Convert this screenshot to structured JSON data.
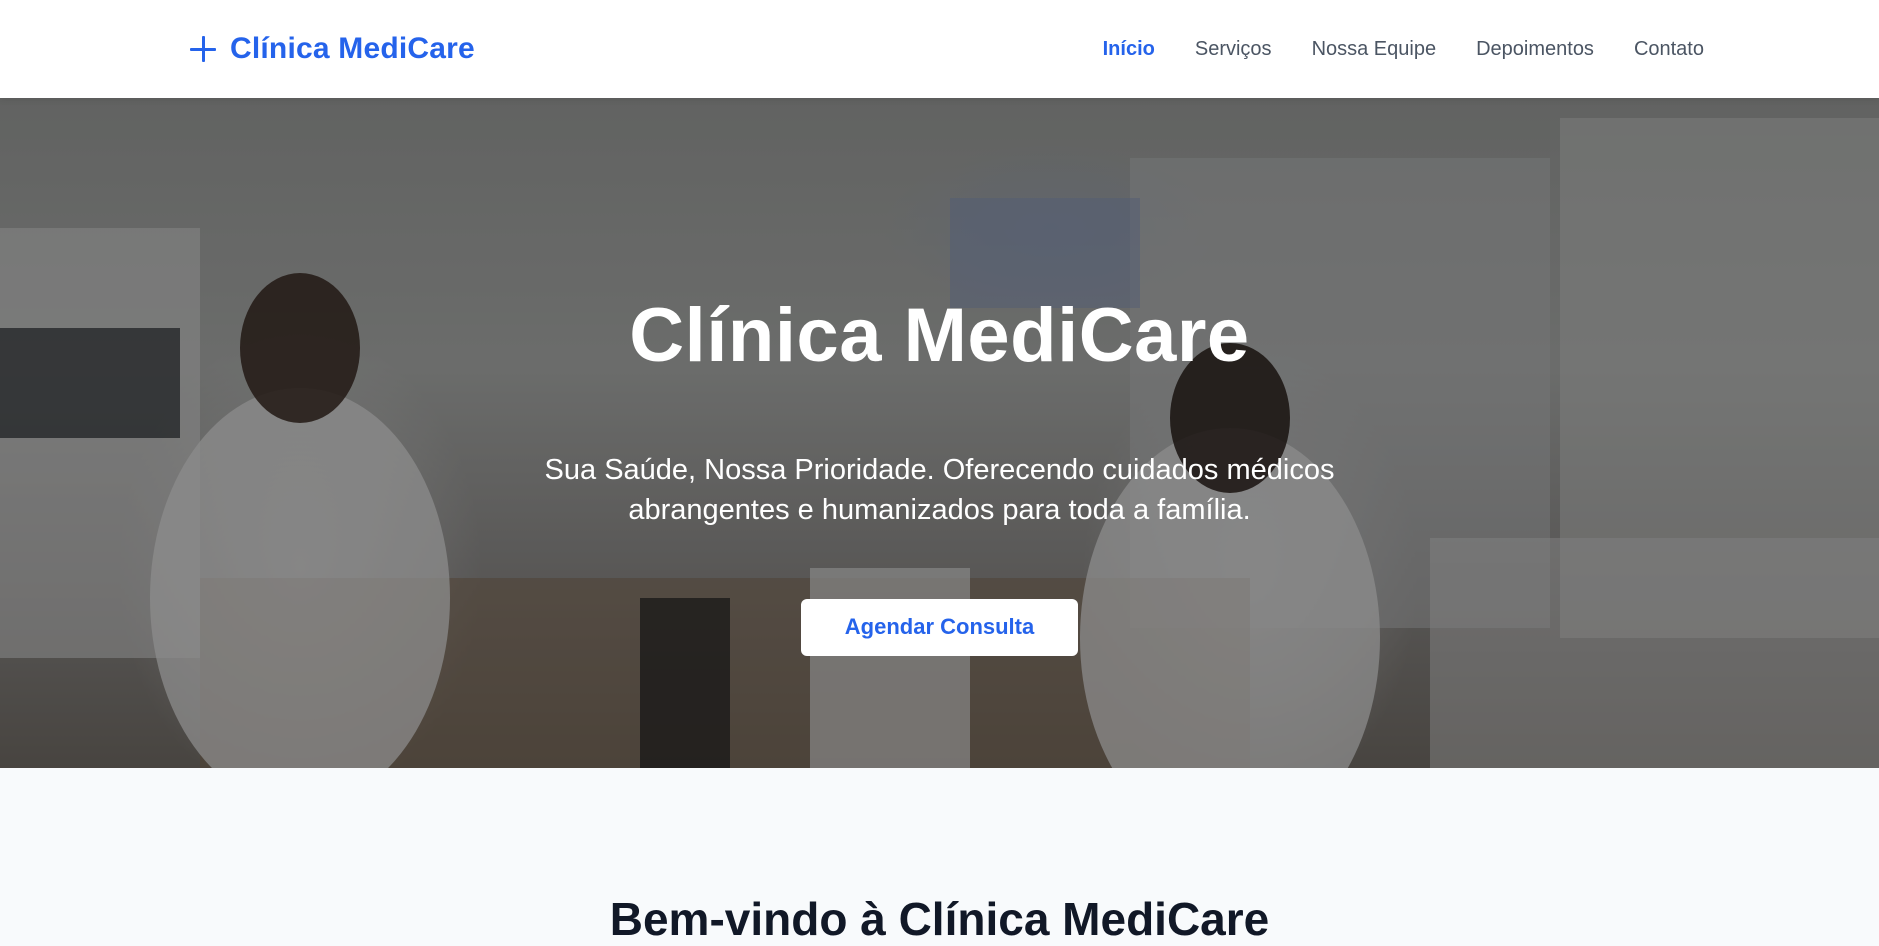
{
  "header": {
    "brand_icon": "plus-icon",
    "brand_name": "Clínica MediCare",
    "nav": [
      {
        "label": "Início",
        "active": true
      },
      {
        "label": "Serviços",
        "active": false
      },
      {
        "label": "Nossa Equipe",
        "active": false
      },
      {
        "label": "Depoimentos",
        "active": false
      },
      {
        "label": "Contato",
        "active": false
      }
    ]
  },
  "hero": {
    "title": "Clínica MediCare",
    "subtitle": "Sua Saúde, Nossa Prioridade. Oferecendo cuidados médicos abrangentes e humanizados para toda a família.",
    "cta_label": "Agendar Consulta"
  },
  "welcome": {
    "title": "Bem-vindo à Clínica MediCare"
  },
  "colors": {
    "accent": "#2563eb",
    "nav_text": "#4b5563",
    "heading": "#111827",
    "section_bg": "#f8fafc"
  }
}
